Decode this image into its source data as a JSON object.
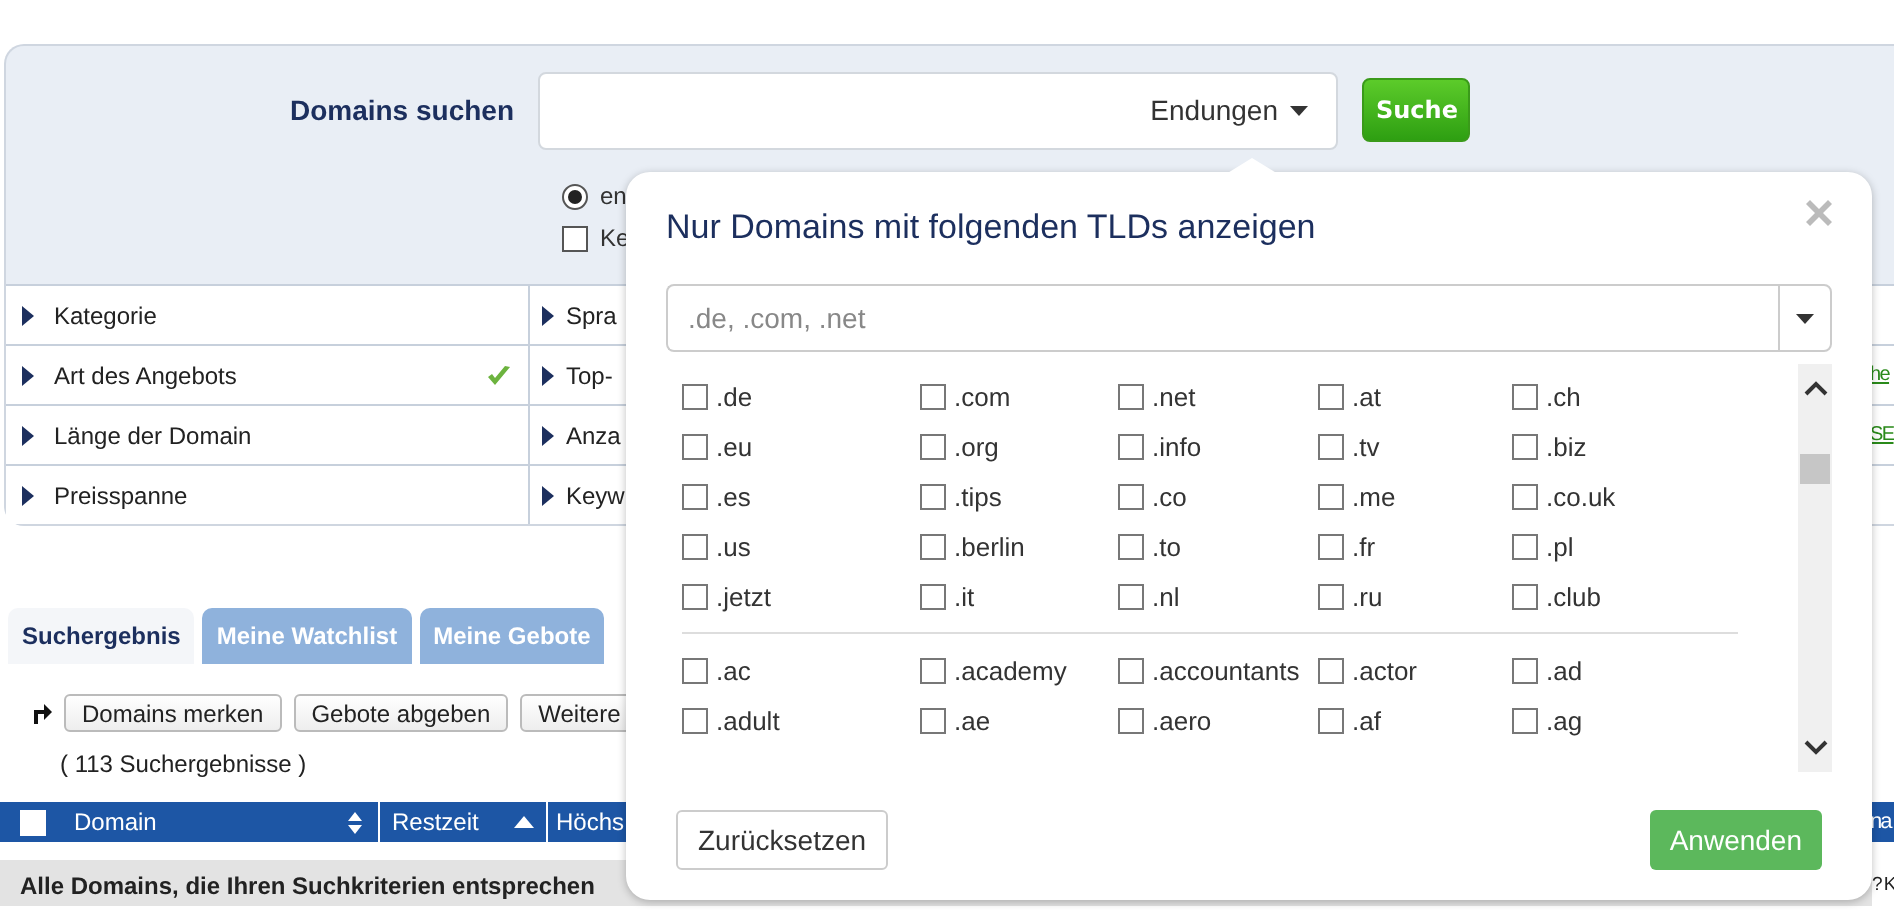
{
  "search": {
    "label": "Domains suchen",
    "endings_button": "Endungen",
    "search_button": "Suche"
  },
  "options": [
    {
      "kind": "radio",
      "label": "en",
      "checked": true
    },
    {
      "kind": "checkbox",
      "label": "Ke",
      "checked": false
    }
  ],
  "filters": [
    {
      "label": "Kategorie",
      "active": false,
      "column_2": "Spra"
    },
    {
      "label": "Art des Angebots",
      "active": true,
      "column_2": "Top-",
      "link": "he"
    },
    {
      "label": "Länge der Domain",
      "active": false,
      "column_2": "Anza",
      "link": "SE"
    },
    {
      "label": "Preisspanne",
      "active": false,
      "column_2": "Keyw"
    }
  ],
  "tabs": [
    {
      "label": "Suchergebnis",
      "selected": true
    },
    {
      "label": "Meine Watchlist",
      "selected": false
    },
    {
      "label": "Meine Gebote",
      "selected": false
    }
  ],
  "toolbar": {
    "buttons": [
      "Domains merken",
      "Gebote abgeben",
      "Weitere"
    ]
  },
  "result_count": "( 113 Suchergebnisse )",
  "table": {
    "select_all_checked": false,
    "columns": [
      {
        "label": "Domain",
        "sortable": true
      },
      {
        "label": "Restzeit",
        "sorted_ascending": true
      },
      {
        "label": "Höchs"
      },
      {
        "label": "na"
      }
    ],
    "group_row": "Alle Domains, die Ihren Suchkriterien entsprechen",
    "group_row_right": "? K"
  },
  "tld_popover": {
    "title": "Nur Domains mit folgenden TLDs anzeigen",
    "placeholder": ".de, .com, .net",
    "groups": [
      {
        "items": [
          {
            "label": ".de",
            "checked": false
          },
          {
            "label": ".com",
            "checked": false
          },
          {
            "label": ".net",
            "checked": false
          },
          {
            "label": ".at",
            "checked": false
          },
          {
            "label": ".ch",
            "checked": false
          },
          {
            "label": ".eu",
            "checked": false
          },
          {
            "label": ".org",
            "checked": false
          },
          {
            "label": ".info",
            "checked": false
          },
          {
            "label": ".tv",
            "checked": false
          },
          {
            "label": ".biz",
            "checked": false
          },
          {
            "label": ".es",
            "checked": false
          },
          {
            "label": ".tips",
            "checked": false
          },
          {
            "label": ".co",
            "checked": false
          },
          {
            "label": ".me",
            "checked": false
          },
          {
            "label": ".co.uk",
            "checked": false
          },
          {
            "label": ".us",
            "checked": false
          },
          {
            "label": ".berlin",
            "checked": false
          },
          {
            "label": ".to",
            "checked": false
          },
          {
            "label": ".fr",
            "checked": false
          },
          {
            "label": ".pl",
            "checked": false
          },
          {
            "label": ".jetzt",
            "checked": false
          },
          {
            "label": ".it",
            "checked": false
          },
          {
            "label": ".nl",
            "checked": false
          },
          {
            "label": ".ru",
            "checked": false
          },
          {
            "label": ".club",
            "checked": false
          }
        ]
      },
      {
        "items": [
          {
            "label": ".ac",
            "checked": false
          },
          {
            "label": ".academy",
            "checked": false
          },
          {
            "label": ".accountants",
            "checked": false
          },
          {
            "label": ".actor",
            "checked": false
          },
          {
            "label": ".ad",
            "checked": false
          },
          {
            "label": ".adult",
            "checked": false
          },
          {
            "label": ".ae",
            "checked": false
          },
          {
            "label": ".aero",
            "checked": false
          },
          {
            "label": ".af",
            "checked": false
          },
          {
            "label": ".ag",
            "checked": false
          }
        ]
      }
    ],
    "reset_button": "Zurücksetzen",
    "apply_button": "Anwenden"
  }
}
